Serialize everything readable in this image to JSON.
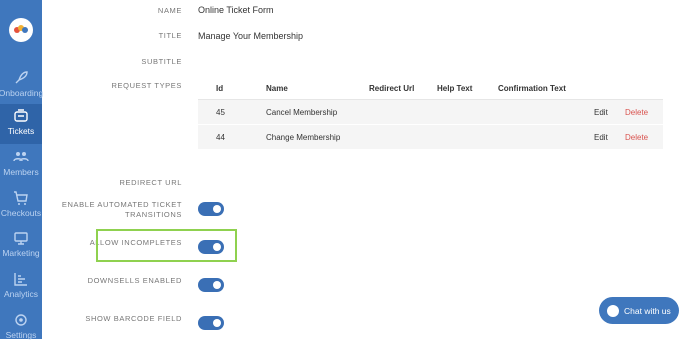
{
  "sidebar": {
    "logo_text": "",
    "items": [
      {
        "label": "Onboarding",
        "icon": "rocket-icon",
        "active": false
      },
      {
        "label": "Tickets",
        "icon": "ticket-icon",
        "active": true
      },
      {
        "label": "Members",
        "icon": "members-icon",
        "active": false
      },
      {
        "label": "Checkouts",
        "icon": "cart-icon",
        "active": false
      },
      {
        "label": "Marketing",
        "icon": "marketing-icon",
        "active": false
      },
      {
        "label": "Analytics",
        "icon": "analytics-icon",
        "active": false
      },
      {
        "label": "Settings",
        "icon": "gear-icon",
        "active": false
      }
    ]
  },
  "form": {
    "name_label": "NAME",
    "name_value": "Online Ticket Form",
    "title_label": "TITLE",
    "title_value": "Manage Your Membership",
    "subtitle_label": "SUBTITLE",
    "subtitle_value": "",
    "request_types_label": "REQUEST TYPES",
    "redirect_url_label": "REDIRECT URL",
    "redirect_url_value": "",
    "auto_transitions_label_1": "ENABLE AUTOMATED TICKET",
    "auto_transitions_label_2": "TRANSITIONS",
    "allow_incompletes_label": "ALLOW INCOMPLETES",
    "downsells_label": "DOWNSELLS ENABLED",
    "barcode_label": "SHOW BARCODE FIELD",
    "toggles": {
      "auto_transitions": true,
      "allow_incompletes": true,
      "downsells": true,
      "barcode": true
    }
  },
  "request_types": {
    "headers": [
      "Id",
      "Name",
      "Redirect Url",
      "Help Text",
      "Confirmation Text"
    ],
    "rows": [
      {
        "id": "45",
        "name": "Cancel Membership",
        "redirect": "",
        "help": "",
        "confirmation": "",
        "edit": "Edit",
        "delete": "Delete"
      },
      {
        "id": "44",
        "name": "Change Membership",
        "redirect": "",
        "help": "",
        "confirmation": "",
        "edit": "Edit",
        "delete": "Delete"
      }
    ]
  },
  "chat": {
    "label": "Chat with us"
  },
  "colors": {
    "sidebar": "#3f77bd",
    "sidebar_active": "#2f64a8",
    "toggle_on": "#3a6fb5",
    "delete": "#d9534f",
    "highlight": "#8fd14f"
  }
}
